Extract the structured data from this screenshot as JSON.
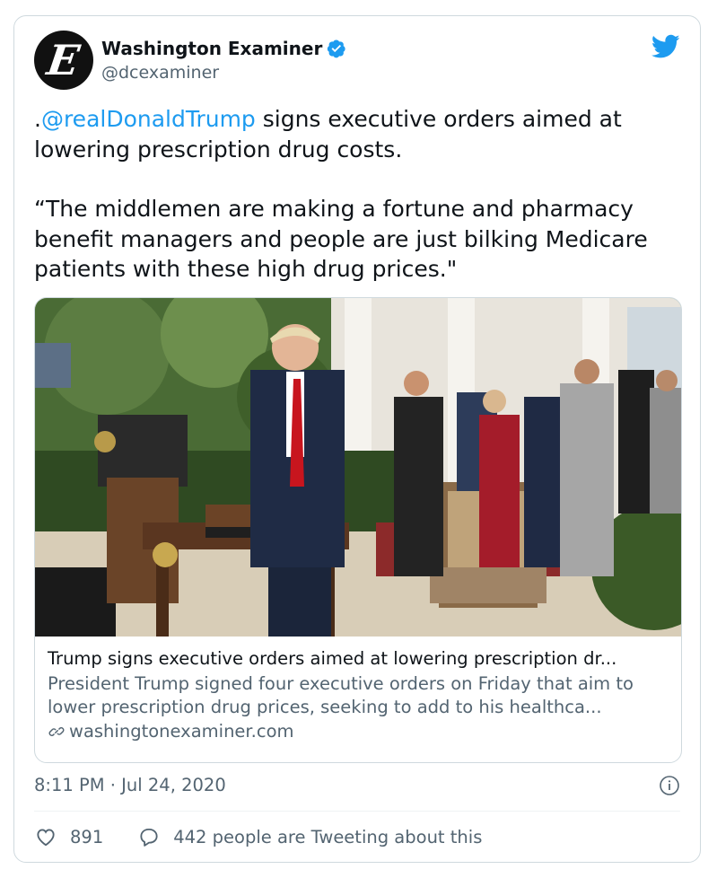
{
  "account": {
    "name": "Washington Examiner",
    "handle": "@dcexaminer",
    "avatar_letter": "E",
    "verified_color": "#1d9bf0"
  },
  "tweet": {
    "prefix": ".",
    "mention": "@realDonaldTrump",
    "line1_rest": " signs executive orders aimed at lowering prescription drug costs.",
    "quote": "“The middlemen are making a fortune and pharmacy benefit managers and people are just bilking Medicare patients with these high drug prices.\""
  },
  "link_card": {
    "title": "Trump signs executive orders aimed at lowering prescription dr...",
    "description": "President Trump signed four executive orders on Friday that aim to lower prescription drug prices, seeking to add to his healthca...",
    "domain": "washingtonexaminer.com"
  },
  "timestamp": "8:11 PM · Jul 24, 2020",
  "actions": {
    "likes": "891",
    "replies_text": "442 people are Tweeting about this"
  },
  "colors": {
    "accent": "#1d9bf0",
    "text": "#0f1419",
    "secondary": "#536471",
    "border": "#cfd9de"
  },
  "icons": [
    "avatar-logo",
    "verified-badge-icon",
    "twitter-bird-icon",
    "link-icon",
    "info-icon",
    "heart-icon",
    "reply-bubble-icon"
  ]
}
